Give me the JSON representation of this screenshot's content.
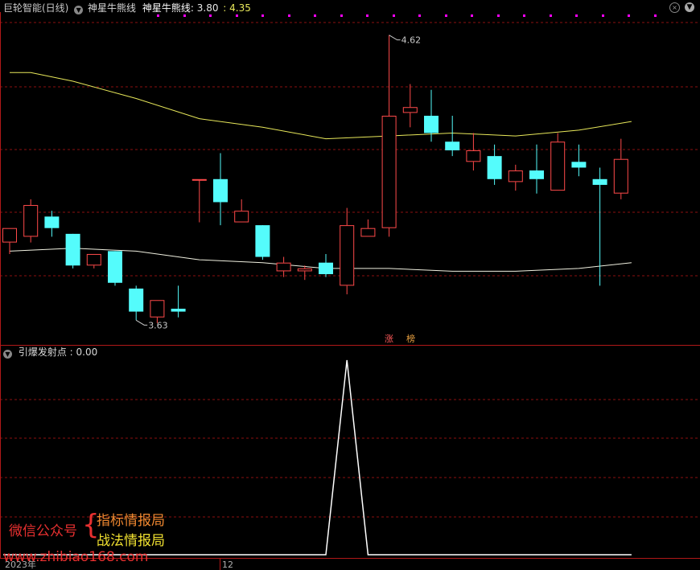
{
  "header": {
    "app_title": "巨轮智能(日线)",
    "indicator_name": "神星牛熊线",
    "indicator_label": "神星牛熊线:",
    "value_1": "3.80",
    "separator": ":",
    "value_2": "4.35"
  },
  "sub_panel": {
    "indicator_label": "引爆发射点",
    "value": ": 0.00"
  },
  "badges": {
    "zhang": "涨",
    "bang": "榜"
  },
  "x_axis": {
    "year_label": "2023年",
    "month_label": "12"
  },
  "watermark": {
    "label": "微信公众号",
    "name_1": "指标情报局",
    "name_2": "战法情报局",
    "url": "www.zhibiao168.com"
  },
  "colors": {
    "up": "#ff4a4a",
    "down": "#54fcfc",
    "upper_line": "#e8e85a",
    "lower_line": "#f0f0e0",
    "grid": "#8b1010",
    "dot": "#ff00ff",
    "signal": "#ffffff"
  },
  "chart_data": {
    "type": "candlestick",
    "y_range": [
      3.55,
      4.7
    ],
    "high_annotation": "4.62",
    "low_annotation": "3.63",
    "candles": [
      {
        "o": 3.9,
        "h": 3.95,
        "l": 3.86,
        "c": 3.95,
        "dir": "up"
      },
      {
        "o": 3.92,
        "h": 4.05,
        "l": 3.9,
        "c": 4.03,
        "dir": "up"
      },
      {
        "o": 3.99,
        "h": 4.01,
        "l": 3.92,
        "c": 3.95,
        "dir": "down"
      },
      {
        "o": 3.93,
        "h": 3.93,
        "l": 3.81,
        "c": 3.82,
        "dir": "down"
      },
      {
        "o": 3.82,
        "h": 3.86,
        "l": 3.81,
        "c": 3.86,
        "dir": "up"
      },
      {
        "o": 3.87,
        "h": 3.87,
        "l": 3.75,
        "c": 3.76,
        "dir": "down"
      },
      {
        "o": 3.74,
        "h": 3.75,
        "l": 3.63,
        "c": 3.66,
        "dir": "down"
      },
      {
        "o": 3.64,
        "h": 3.7,
        "l": 3.62,
        "c": 3.7,
        "dir": "up"
      },
      {
        "o": 3.67,
        "h": 3.75,
        "l": 3.64,
        "c": 3.66,
        "dir": "down"
      },
      {
        "o": 4.12,
        "h": 4.12,
        "l": 3.97,
        "c": 4.12,
        "dir": "up"
      },
      {
        "o": 4.12,
        "h": 4.21,
        "l": 3.96,
        "c": 4.04,
        "dir": "down"
      },
      {
        "o": 3.97,
        "h": 4.05,
        "l": 3.97,
        "c": 4.01,
        "dir": "up"
      },
      {
        "o": 3.96,
        "h": 3.96,
        "l": 3.84,
        "c": 3.85,
        "dir": "down"
      },
      {
        "o": 3.8,
        "h": 3.85,
        "l": 3.78,
        "c": 3.83,
        "dir": "up"
      },
      {
        "o": 3.8,
        "h": 3.82,
        "l": 3.77,
        "c": 3.81,
        "dir": "up"
      },
      {
        "o": 3.83,
        "h": 3.86,
        "l": 3.78,
        "c": 3.79,
        "dir": "down"
      },
      {
        "o": 3.75,
        "h": 4.02,
        "l": 3.72,
        "c": 3.96,
        "dir": "up"
      },
      {
        "o": 3.92,
        "h": 3.98,
        "l": 3.92,
        "c": 3.95,
        "dir": "up"
      },
      {
        "o": 3.95,
        "h": 4.62,
        "l": 3.92,
        "c": 4.34,
        "dir": "up"
      },
      {
        "o": 4.35,
        "h": 4.45,
        "l": 4.3,
        "c": 4.37,
        "dir": "up"
      },
      {
        "o": 4.34,
        "h": 4.43,
        "l": 4.25,
        "c": 4.28,
        "dir": "down"
      },
      {
        "o": 4.25,
        "h": 4.34,
        "l": 4.2,
        "c": 4.22,
        "dir": "down"
      },
      {
        "o": 4.18,
        "h": 4.28,
        "l": 4.15,
        "c": 4.22,
        "dir": "up"
      },
      {
        "o": 4.2,
        "h": 4.24,
        "l": 4.1,
        "c": 4.12,
        "dir": "down"
      },
      {
        "o": 4.11,
        "h": 4.17,
        "l": 4.08,
        "c": 4.15,
        "dir": "up"
      },
      {
        "o": 4.15,
        "h": 4.24,
        "l": 4.07,
        "c": 4.12,
        "dir": "down"
      },
      {
        "o": 4.08,
        "h": 4.28,
        "l": 4.08,
        "c": 4.25,
        "dir": "up"
      },
      {
        "o": 4.18,
        "h": 4.24,
        "l": 4.13,
        "c": 4.16,
        "dir": "down"
      },
      {
        "o": 4.12,
        "h": 4.16,
        "l": 3.75,
        "c": 4.1,
        "dir": "down"
      },
      {
        "o": 4.07,
        "h": 4.26,
        "l": 4.05,
        "c": 4.19,
        "dir": "up"
      }
    ],
    "upper_line": {
      "x_idx": [
        0,
        1,
        3,
        6,
        9,
        12,
        15,
        18,
        21,
        24,
        27,
        29.5
      ],
      "y": [
        4.49,
        4.49,
        4.46,
        4.4,
        4.33,
        4.3,
        4.26,
        4.27,
        4.28,
        4.27,
        4.29,
        4.32
      ]
    },
    "lower_line": {
      "x_idx": [
        0,
        3,
        6,
        9,
        12,
        15,
        18,
        21,
        24,
        27,
        29.5
      ],
      "y": [
        3.87,
        3.88,
        3.87,
        3.84,
        3.83,
        3.81,
        3.81,
        3.8,
        3.8,
        3.81,
        3.83
      ]
    },
    "signal": {
      "y_range": [
        0,
        1
      ],
      "x_idx": [
        -0.3,
        15,
        16,
        17,
        29.5
      ],
      "values": [
        0,
        0,
        1,
        0,
        0
      ]
    }
  }
}
